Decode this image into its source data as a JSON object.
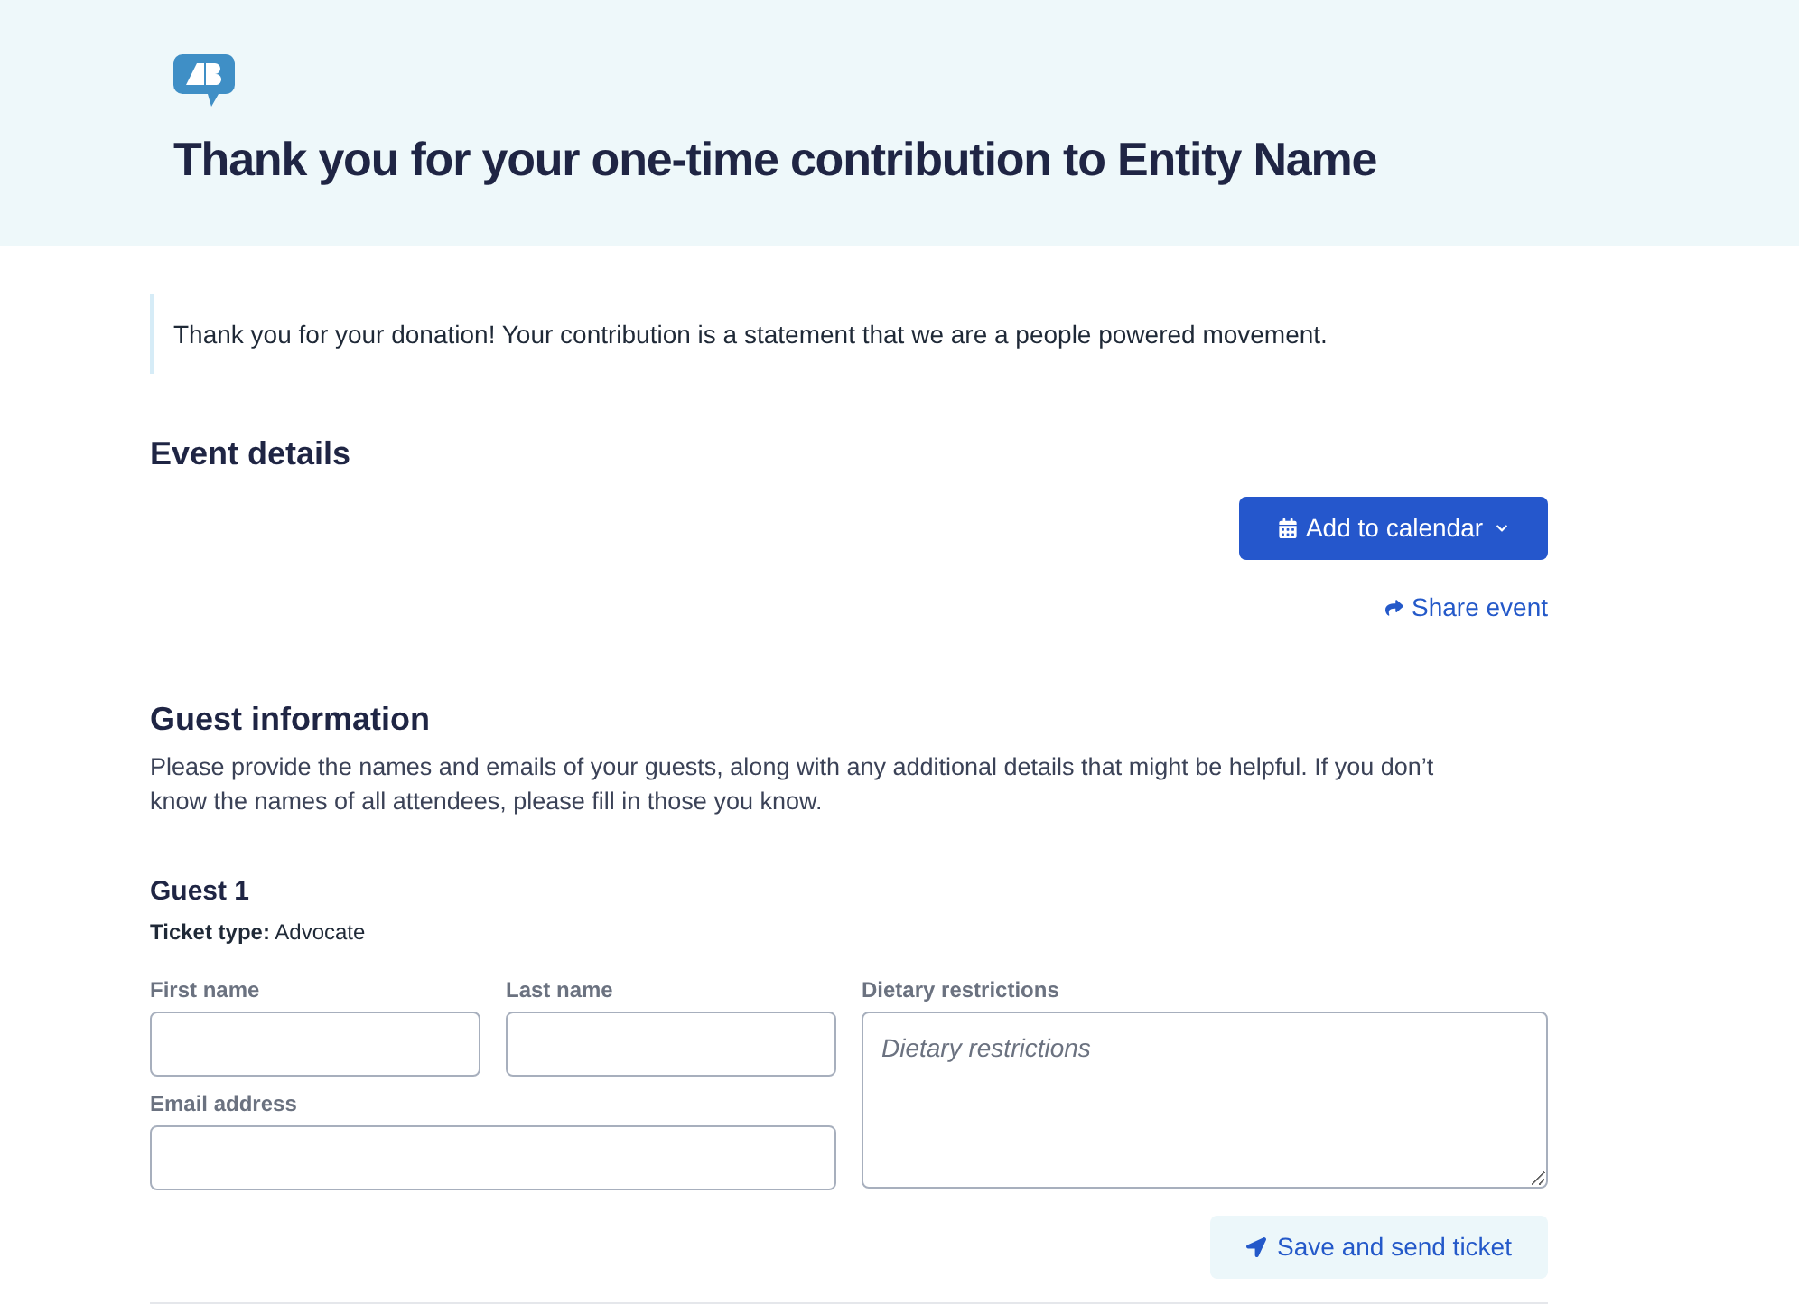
{
  "header": {
    "title": "Thank you for your one-time contribution to Entity Name"
  },
  "notice": {
    "text": "Thank you for your donation! Your contribution is a statement that we are a people powered movement."
  },
  "event_details": {
    "heading": "Event details",
    "calendar_button": "Add to calendar",
    "share_link": "Share event"
  },
  "guest_information": {
    "heading": "Guest information",
    "description": "Please provide the names and emails of your guests, along with any additional details that might be helpful. If you don’t know the names of all attendees, please fill in those you know."
  },
  "guests": [
    {
      "heading": "Guest 1",
      "ticket_type": "**Ticket type:** Advocate",
      "first_name": {
        "label": "First name"
      },
      "last_name": {
        "label": "Last name"
      },
      "dietary_restrictions": {
        "label": "Dietary restrictions",
        "placeholder": "Dietary restrictions"
      },
      "email": {
        "label": "Email address"
      },
      "save_button": "Save and send ticket"
    }
  ]
}
